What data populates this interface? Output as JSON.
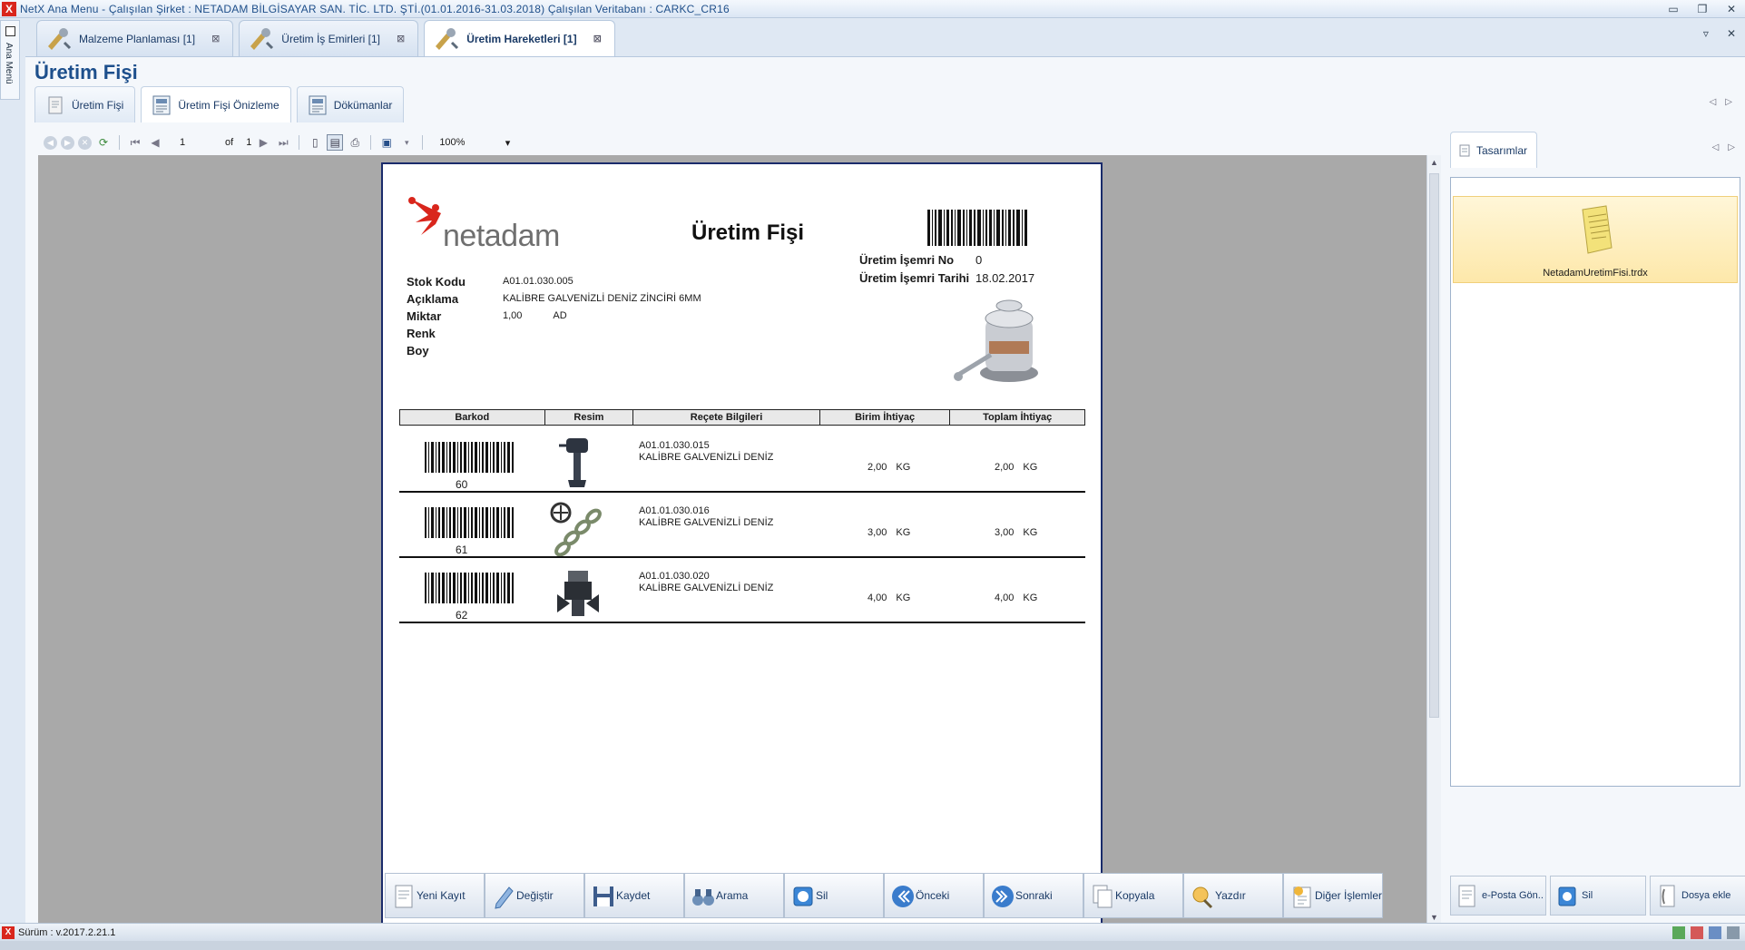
{
  "window": {
    "title": "NetX Ana Menu - Çalışılan Şirket : NETADAM BİLGİSAYAR SAN. TİC. LTD. ŞTİ.(01.01.2016-31.03.2018) Çalışılan Veritabanı : CARKC_CR16",
    "app_icon": "X",
    "minimize": "▭",
    "restore": "❐",
    "close": "✕"
  },
  "side": {
    "ana_menu": "Ana Menü"
  },
  "doc_tabs": [
    {
      "label": "Malzeme Planlaması [1]",
      "close": "⊠"
    },
    {
      "label": "Üretim İş Emirleri [1]",
      "close": "⊠"
    },
    {
      "label": "Üretim Hareketleri [1]",
      "close": "⊠"
    }
  ],
  "tab_menu": {
    "dropdown": "▿",
    "close": "✕"
  },
  "page_title": "Üretim Fişi",
  "sub_tabs": [
    {
      "label": "Üretim Fişi"
    },
    {
      "label": "Üretim Fişi Önizleme"
    },
    {
      "label": "Dökümanlar"
    }
  ],
  "sub_tab_arrows": {
    "prev": "◁",
    "next": "▷"
  },
  "preview_toolbar": {
    "page_current": "1",
    "of_label": "of",
    "page_total": "1",
    "zoom": "100%",
    "zoom_arrow": "▾"
  },
  "report": {
    "logo_text": "netadam",
    "title": "Üretim Fişi",
    "is_emri_no_label": "Üretim İşemri No",
    "is_emri_no": "0",
    "is_emri_tarihi_label": "Üretim İşemri Tarihi",
    "is_emri_tarihi": "18.02.2017",
    "fields": [
      {
        "label": "Stok Kodu",
        "value": "A01.01.030.005",
        "unit": ""
      },
      {
        "label": "Açıklama",
        "value": "KALİBRE GALVENİZLİ DENİZ ZİNCİRİ  6MM",
        "unit": ""
      },
      {
        "label": "Miktar",
        "value": "1,00",
        "unit": "AD"
      },
      {
        "label": "Renk",
        "value": "",
        "unit": ""
      },
      {
        "label": "Boy",
        "value": "",
        "unit": ""
      }
    ],
    "columns": [
      "Barkod",
      "Resim",
      "Reçete Bilgileri",
      "Birim İhtiyaç",
      "Toplam İhtiyaç"
    ],
    "rows": [
      {
        "barcode_num": "60",
        "code": "A01.01.030.015",
        "desc": "KALİBRE GALVENİZLİ DENİZ",
        "birim": "2,00",
        "birim_unit": "KG",
        "toplam": "2,00",
        "toplam_unit": "KG"
      },
      {
        "barcode_num": "61",
        "code": "A01.01.030.016",
        "desc": "KALİBRE GALVENİZLİ DENİZ",
        "birim": "3,00",
        "birim_unit": "KG",
        "toplam": "3,00",
        "toplam_unit": "KG"
      },
      {
        "barcode_num": "62",
        "code": "A01.01.030.020",
        "desc": "KALİBRE GALVENİZLİ DENİZ",
        "birim": "4,00",
        "birim_unit": "KG",
        "toplam": "4,00",
        "toplam_unit": "KG"
      }
    ]
  },
  "right_panel": {
    "tab": "Tasarımlar",
    "arrows": {
      "prev": "◁",
      "next": "▷"
    },
    "file": "NetadamUretimFisi.trdx",
    "buttons": [
      "e-Posta Gön..",
      "Sil",
      "Dosya ekle"
    ]
  },
  "actions": [
    "Yeni Kayıt",
    "Değiştir",
    "Kaydet",
    "Arama",
    "Sil",
    "Önceki",
    "Sonraki",
    "Kopyala",
    "Yazdır",
    "Diğer İşlemler"
  ],
  "status": {
    "icon": "X",
    "version": "Sürüm : v.2017.2.21.1"
  },
  "colors": {
    "accent": "#1d4f8c",
    "brand_red": "#d9261c",
    "report_border": "#1a2b6b"
  }
}
